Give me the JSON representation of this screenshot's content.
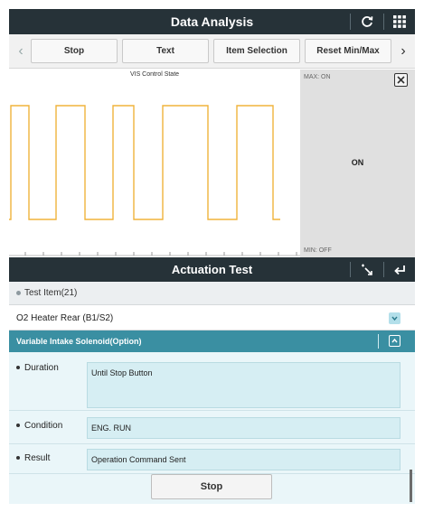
{
  "header": {
    "title": "Data Analysis",
    "icons": [
      "refresh-icon",
      "grid-menu-icon"
    ]
  },
  "toolbar": {
    "buttons": [
      "Stop",
      "Text",
      "Item Selection",
      "Reset Min/Max"
    ],
    "prev_icon": "chevron-left-icon",
    "next_icon": "chevron-right-icon"
  },
  "chart": {
    "title": "VIS Control State",
    "max_label": "MAX: ON",
    "min_label": "MIN: OFF",
    "current_value": "ON",
    "close_icon": "close-icon",
    "line_color": "#f0b33c"
  },
  "chart_data": {
    "type": "line",
    "title": "VIS Control State",
    "xlabel": "",
    "ylabel": "",
    "levels": [
      "OFF",
      "ON"
    ],
    "x": [
      0,
      2,
      2,
      22,
      22,
      52,
      52,
      84,
      84,
      115,
      115,
      138,
      138,
      170,
      170,
      220,
      220,
      252,
      252,
      292,
      292,
      300
    ],
    "y": [
      0,
      0,
      1,
      1,
      0,
      0,
      1,
      1,
      0,
      0,
      1,
      1,
      0,
      0,
      1,
      1,
      0,
      0,
      1,
      1,
      0,
      0
    ],
    "xlim": [
      0,
      310
    ],
    "ylim": [
      0,
      1
    ]
  },
  "actuation": {
    "title": "Actuation Test",
    "icons": [
      "touch-select-icon",
      "back-arrow-icon"
    ],
    "test_item_header": "Test Item(21)",
    "items": [
      {
        "label": "O2 Heater Rear (B1/S2)",
        "selected": false
      },
      {
        "label": "Variable Intake Solenoid(Option)",
        "selected": true
      }
    ],
    "details": [
      {
        "key": "Duration",
        "value": "Until Stop Button"
      },
      {
        "key": "Condition",
        "value": "ENG. RUN"
      },
      {
        "key": "Result",
        "value": "Operation Command Sent"
      }
    ],
    "stop_label": "Stop"
  },
  "colors": {
    "header_bg": "#263238",
    "selected_row_bg": "#3a8fa2",
    "detail_bg": "#eaf6f9",
    "waveform": "#f0b33c"
  }
}
